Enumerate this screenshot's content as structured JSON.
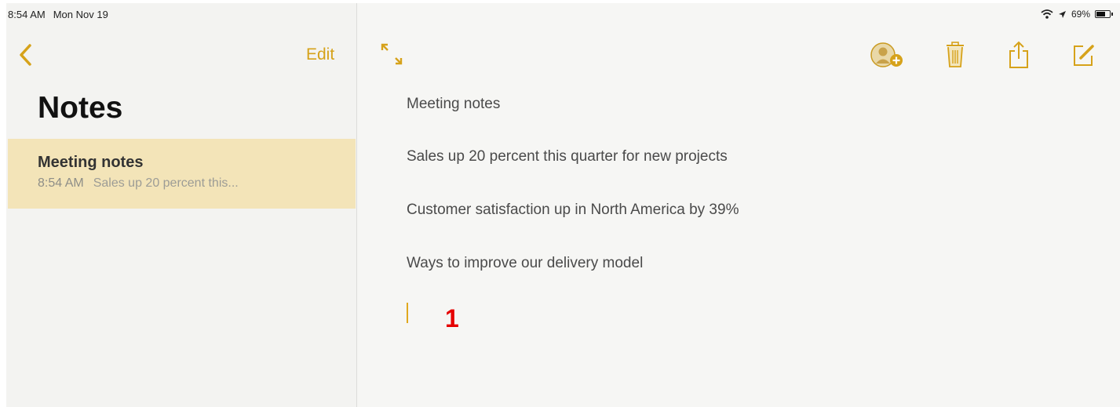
{
  "status_bar": {
    "time": "8:54 AM",
    "date": "Mon Nov 19",
    "battery_text": "69%",
    "battery_level": 0.69,
    "wifi_icon": "wifi-icon",
    "location_icon": "location-icon"
  },
  "sidebar": {
    "back_icon": "chevron-left-icon",
    "edit_label": "Edit",
    "title": "Notes",
    "notes": [
      {
        "title": "Meeting notes",
        "time": "8:54 AM",
        "preview": "Sales up 20 percent this..."
      }
    ]
  },
  "toolbar": {
    "expand_icon": "expand-icon",
    "add_people_icon": "add-people-icon",
    "trash_icon": "trash-icon",
    "share_icon": "share-icon",
    "compose_icon": "compose-icon"
  },
  "note": {
    "lines": [
      "Meeting notes",
      "Sales up 20 percent this quarter for new projects",
      "Customer satisfaction up in North America by 39%",
      "Ways to improve our delivery model"
    ]
  },
  "annotation": {
    "label": "1"
  },
  "colors": {
    "accent": "#d6a21a",
    "selected_row": "#f3e4b8",
    "annotation": "#e60000"
  }
}
